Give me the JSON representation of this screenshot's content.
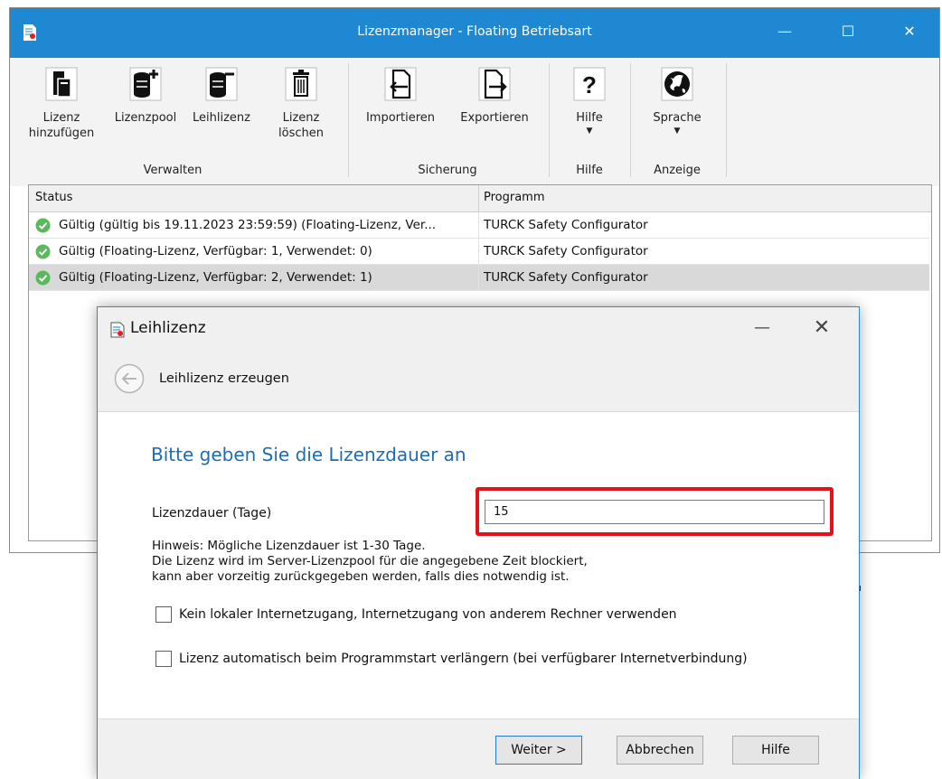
{
  "main_window": {
    "title": "Lizenzmanager - Floating Betriebsart",
    "controls": {
      "minimize": "—",
      "maximize": "☐",
      "close": "✕"
    },
    "accent_color": "#1f88d2"
  },
  "ribbon": {
    "groups": [
      {
        "label": "Verwalten",
        "buttons": [
          {
            "label_1": "Lizenz",
            "label_2": "hinzufügen",
            "icon": "add-license-icon"
          },
          {
            "label_1": "Lizenzpool",
            "icon": "license-pool-icon"
          },
          {
            "label_1": "Leihlizenz",
            "icon": "borrow-license-icon"
          },
          {
            "label_1": "Lizenz",
            "label_2": "löschen",
            "icon": "trash-icon"
          }
        ]
      },
      {
        "label": "Sicherung",
        "buttons": [
          {
            "label_1": "Importieren",
            "icon": "import-icon"
          },
          {
            "label_1": "Exportieren",
            "icon": "export-icon"
          }
        ]
      },
      {
        "label": "Hilfe",
        "buttons": [
          {
            "label_1": "Hilfe",
            "icon": "question-mark-icon",
            "has_dropdown": true
          }
        ]
      },
      {
        "label": "Anzeige",
        "buttons": [
          {
            "label_1": "Sprache",
            "icon": "globe-icon",
            "has_dropdown": true
          }
        ]
      }
    ]
  },
  "table": {
    "columns": [
      "Status",
      "Programm"
    ],
    "rows": [
      {
        "status": "Gültig (gültig bis 19.11.2023 23:59:59) (Floating-Lizenz, Ver...",
        "program": "TURCK Safety Configurator",
        "selected": false
      },
      {
        "status": "Gültig (Floating-Lizenz, Verfügbar: 1, Verwendet: 0)",
        "program": "TURCK Safety Configurator",
        "selected": false
      },
      {
        "status": "Gültig (Floating-Lizenz, Verfügbar: 2, Verwendet: 1)",
        "program": "TURCK Safety Configurator",
        "selected": true
      }
    ]
  },
  "dialog": {
    "title": "Leihlizenz",
    "nav_title": "Leihlizenz erzeugen",
    "heading": "Bitte geben Sie die Lizenzdauer an",
    "duration_label": "Lizenzdauer (Tage)",
    "duration_value": "15",
    "hint_line_1": "Hinweis: Mögliche Lizenzdauer ist 1-30 Tage.",
    "hint_line_2": "Die Lizenz wird im Server-Lizenzpool für die angegebene Zeit blockiert,",
    "hint_line_3": "kann aber vorzeitig zurückgegeben werden, falls dies notwendig ist.",
    "checkbox_1": "Kein lokaler Internetzugang, Internetzugang von anderem Rechner verwenden",
    "checkbox_1_checked": false,
    "checkbox_2": "Lizenz automatisch beim Programmstart verlängern (bei verfügbarer Internetverbindung)",
    "checkbox_2_checked": false,
    "buttons": {
      "next": "Weiter >",
      "cancel": "Abbrechen",
      "help": "Hilfe"
    },
    "controls": {
      "minimize": "—",
      "close": "✕"
    },
    "heading_color": "#1e6db3",
    "highlight_color": "#e3131b"
  }
}
